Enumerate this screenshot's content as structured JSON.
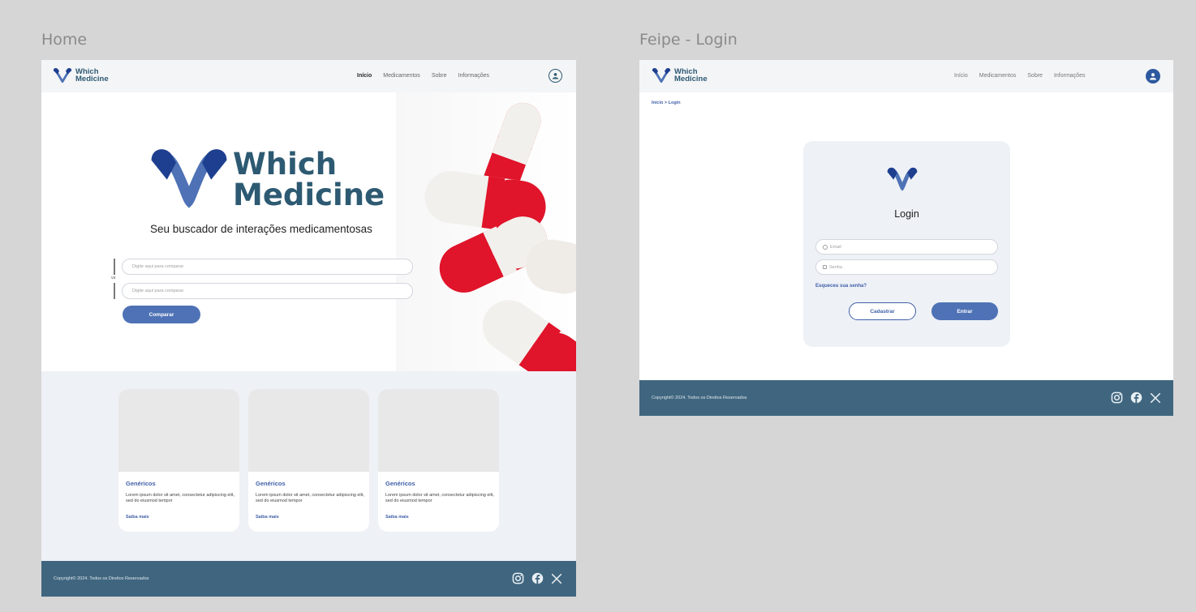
{
  "frames": {
    "home_label": "Home",
    "login_label": "Feipe - Login"
  },
  "brand": {
    "name_line1": "Which",
    "name_line2": "Medicine",
    "colors": {
      "primary": "#4e72b5",
      "dark_blue": "#2d5a72",
      "footer": "#40667f",
      "pill_red": "#e0142a"
    }
  },
  "nav": {
    "items": [
      "Início",
      "Medicamentos",
      "Sobre",
      "Informações"
    ],
    "active": "Início",
    "user_icon": "user-circle-icon"
  },
  "home": {
    "hero_brand_line1": "Which",
    "hero_brand_line2": "Medicine",
    "tagline": "Seu buscador de interações medicamentosas",
    "input1_placeholder": "Digite aqui para comparar",
    "vs_label": "vs",
    "input2_placeholder": "Digite aqui para comparar",
    "compare_button": "Comparar",
    "cards": [
      {
        "title": "Genéricos",
        "text": "Lorem ipsum dolor sit amet, consectetur adipiscing elit, sed do eiusmod tempor",
        "link": "Saiba mais"
      },
      {
        "title": "Genéricos",
        "text": "Lorem ipsum dolor sit amet, consectetur adipiscing elit, sed do eiusmod tempor",
        "link": "Saiba mais"
      },
      {
        "title": "Genéricos",
        "text": "Lorem ipsum dolor sit amet, consectetur adipiscing elit, sed do eiusmod tempor",
        "link": "Saiba mais"
      }
    ]
  },
  "login": {
    "breadcrumb": "Início > Login",
    "title": "Login",
    "email_placeholder": "Email",
    "password_placeholder": "Senha",
    "forgot_link": "Esqueceu sua senha?",
    "register_button": "Cadastrar",
    "submit_button": "Entrar"
  },
  "footer": {
    "copyright": "Copyright© 2024. Todos os Direitos Reservados",
    "social_icons": [
      "instagram-icon",
      "facebook-icon",
      "x-icon"
    ]
  }
}
